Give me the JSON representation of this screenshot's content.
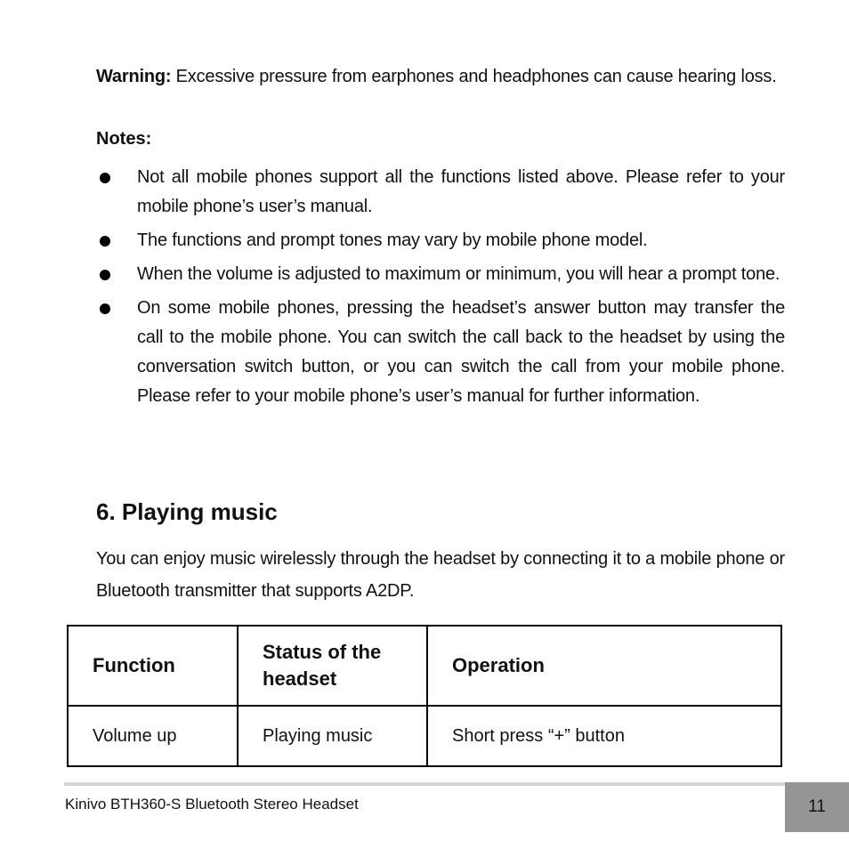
{
  "warning": {
    "label": "Warning:",
    "text": " Excessive pressure from earphones and headphones can cause hearing loss."
  },
  "notes": {
    "heading": "Notes:",
    "items": [
      "Not all mobile phones support all the functions listed above. Please refer to your mobile phone’s user’s manual.",
      "The functions and prompt tones may vary by mobile phone model.",
      "When the volume is adjusted to maximum or minimum, you will hear a prompt tone.",
      "On some mobile phones, pressing the headset’s answer button may transfer the call to the mobile phone. You can switch the call back to the headset by using the conversation switch button, or you can switch the call from your mobile phone. Please refer to your mobile phone’s user’s manual for further information."
    ]
  },
  "section": {
    "title": "6. Playing music",
    "intro": "You can enjoy music wirelessly through the headset by connecting it to a mobile phone or Bluetooth transmitter that supports A2DP."
  },
  "table": {
    "headers": [
      "Function",
      "Status of the headset",
      "Operation"
    ],
    "rows": [
      [
        "Volume up",
        "Playing music",
        "Short press “+” button"
      ]
    ]
  },
  "footer": {
    "title": "Kinivo BTH360-S Bluetooth Stereo Headset",
    "page_number": "11"
  }
}
